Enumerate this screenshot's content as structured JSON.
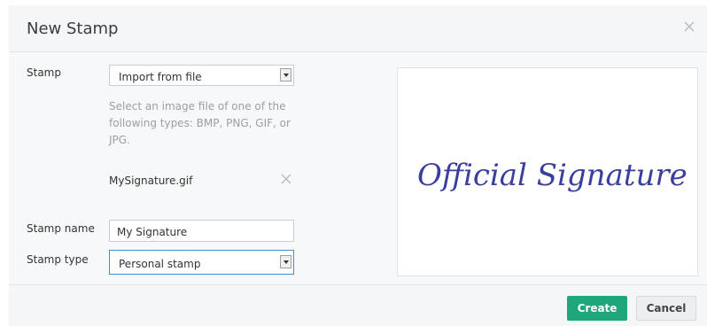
{
  "dialog": {
    "title": "New Stamp",
    "close_icon": "close-icon"
  },
  "form": {
    "stamp_label": "Stamp",
    "stamp_source_value": "Import from file",
    "help_text": "Select an image file of one of the following types: BMP, PNG, GIF, or JPG.",
    "file_name": "MySignature.gif",
    "stamp_name_label": "Stamp name",
    "stamp_name_value": "My Signature",
    "stamp_type_label": "Stamp type",
    "stamp_type_value": "Personal stamp"
  },
  "preview": {
    "signature_text": "Official Signature",
    "ink_color": "#3a3f9e"
  },
  "footer": {
    "create_label": "Create",
    "cancel_label": "Cancel"
  },
  "colors": {
    "accent": "#1fa67a",
    "focus": "#3b8fd9"
  }
}
